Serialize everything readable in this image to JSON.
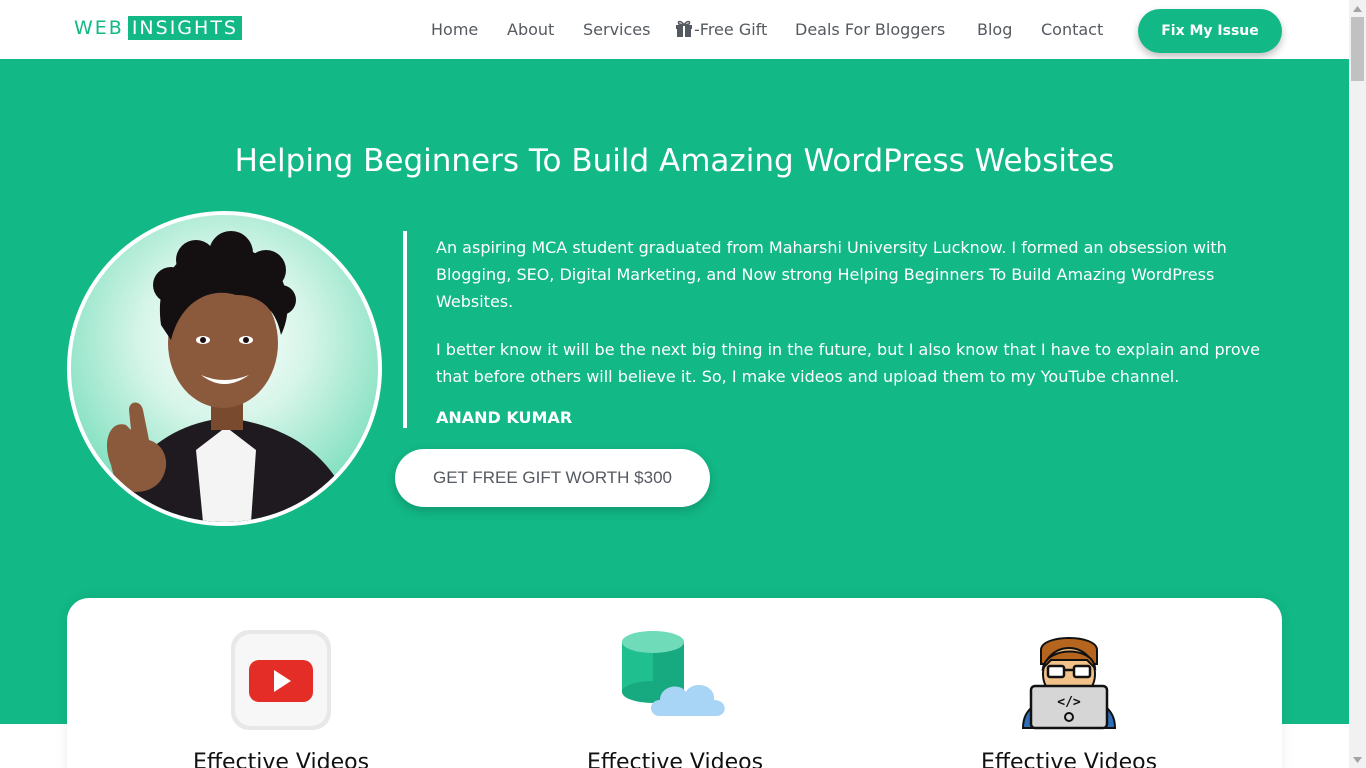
{
  "header": {
    "logo_web": "WEB",
    "logo_insights": "INSIGHTS",
    "nav": [
      {
        "label": "Home"
      },
      {
        "label": "About"
      },
      {
        "label": "Services"
      },
      {
        "label": "-Free Gift",
        "icon": "gift-icon"
      },
      {
        "label": "Deals For Bloggers"
      },
      {
        "label": "Blog"
      },
      {
        "label": "Contact"
      }
    ],
    "cta_label": "Fix My Issue"
  },
  "hero": {
    "title": "Helping Beginners To Build Amazing WordPress Websites",
    "bio_paragraphs": [
      "An aspiring MCA student graduated from Maharshi University Lucknow. I formed an obsession with Blogging, SEO, Digital Marketing, and Now strong Helping Beginners To Build Amazing WordPress Websites.",
      "I better know it will be the next big thing in the future, but I also know that I have to explain and prove that before others will believe it. So, I make videos and upload them to my YouTube channel."
    ],
    "author": "ANAND KUMAR",
    "gift_button": "GET FREE GIFT WORTH $300"
  },
  "features": [
    {
      "title": "Effective Videos",
      "icon": "youtube-icon"
    },
    {
      "title": "Effective Videos",
      "icon": "database-cloud-icon"
    },
    {
      "title": "Effective Videos",
      "icon": "developer-icon"
    }
  ],
  "colors": {
    "brand": "#12b886",
    "nav_text": "#555a60",
    "white": "#ffffff"
  }
}
